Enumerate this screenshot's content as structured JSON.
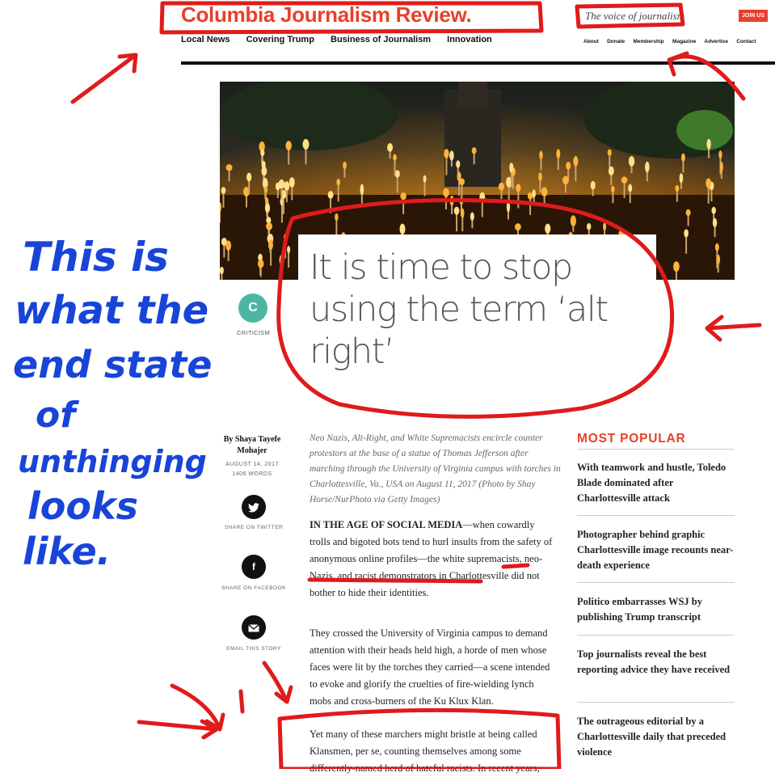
{
  "header": {
    "logo": "Columbia Journalism Review.",
    "tagline": "The voice of journalism",
    "join_label": "JOIN US",
    "main_nav": [
      "Local News",
      "Covering Trump",
      "Business of Journalism",
      "Innovation"
    ],
    "util_nav": [
      "About",
      "Donate",
      "Membership",
      "Magazine",
      "Advertise",
      "Contact"
    ]
  },
  "article": {
    "title": "It is time to stop using the term ‘alt right’",
    "category_badge": "C",
    "category": "CRITICISM",
    "byline": "By Shaya Tayefe Mohajer",
    "date": "AUGUST 14, 2017",
    "words": "1406 WORDS",
    "caption": "Neo Nazis, Alt-Right, and White Supremacists encircle counter protestors at the base of a statue of Thomas Jefferson after marching through the University of Virginia campus with torches in Charlottesville, Va., USA on August 11, 2017 (Photo by Shay Horse/NurPhoto via Getty Images)",
    "lede": "IN THE AGE OF SOCIAL MEDIA",
    "para1": "—when cowardly trolls and bigoted bots tend to hurl insults from the safety of anonymous online profiles—the white supremacists, neo-Nazis, and racist demonstrators in Charlottesville did not bother to hide their identities.",
    "para2": "They crossed the University of Virginia campus to demand attention with their heads held high, a horde of men whose faces were lit by the torches they carried—a scene intended to evoke and glorify the cruelties of fire-wielding lynch mobs and cross-burners of the Ku Klux Klan.",
    "para3": "Yet many of these marchers might bristle at being called Klansmen, per se, counting themselves among some differently-named herd of hateful racists. In recent years,"
  },
  "share": {
    "twitter_label": "SHARE ON TWITTER",
    "twitter_icon": "twitter-icon",
    "facebook_label": "SHARE ON FACEBOOK",
    "facebook_icon": "facebook-icon",
    "email_label": "EMAIL THIS STORY",
    "email_icon": "email-icon"
  },
  "sidebar": {
    "heading": "MOST POPULAR",
    "items": [
      "With teamwork and hustle, Toledo Blade dominated after Charlottesville attack",
      "Photographer behind graphic Charlottesville image recounts near-death experience",
      "Politico embarrasses WSJ by publishing Trump transcript",
      "Top journalists reveal the best reporting advice they have received",
      "The outrageous editorial by a Charlottesville daily that preceded violence"
    ]
  },
  "annotation": {
    "lines": [
      "This is",
      "what the",
      "end state",
      "of",
      "unthinging",
      "looks",
      "like."
    ],
    "ink_red": "#e01b1b",
    "ink_blue": "#1844d8"
  },
  "colors": {
    "brand_red": "#e8402a",
    "badge_teal": "#4cb6a2"
  }
}
